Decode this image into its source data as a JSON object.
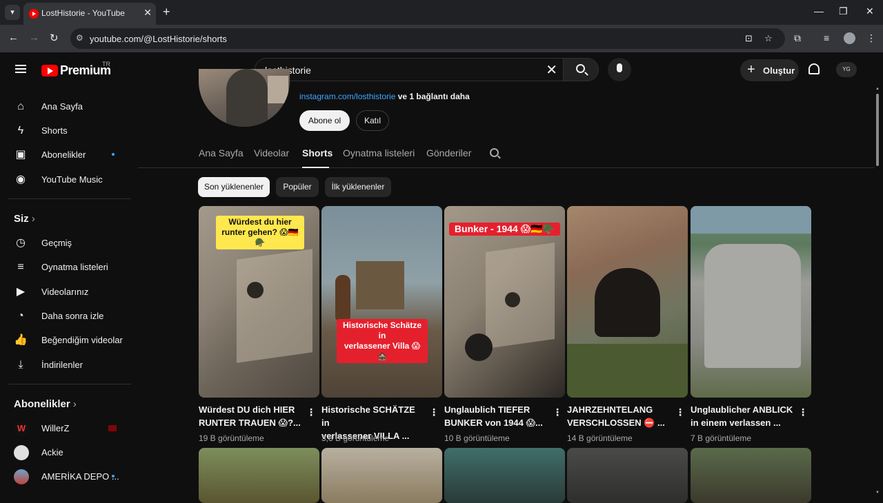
{
  "browser": {
    "tab_title": "LostHistorie - YouTube",
    "url": "youtube.com/@LostHistorie/shorts",
    "close_symbol": "✕",
    "newtab_symbol": "+"
  },
  "header": {
    "logo_text": "Premium",
    "country_code": "TR",
    "search_value": "losthistorie",
    "create_label": "Oluştur",
    "avatar_text": "YG"
  },
  "sidebar": {
    "main_items": [
      {
        "label": "Ana Sayfa",
        "icon": "home-icon"
      },
      {
        "label": "Shorts",
        "icon": "shorts-icon"
      },
      {
        "label": "Abonelikler",
        "icon": "subscriptions-icon",
        "dot": true
      },
      {
        "label": "YouTube Music",
        "icon": "music-icon"
      }
    ],
    "you_heading": "Siz",
    "you_items": [
      {
        "label": "Geçmiş",
        "icon": "history-icon"
      },
      {
        "label": "Oynatma listeleri",
        "icon": "playlists-icon"
      },
      {
        "label": "Videolarınız",
        "icon": "your-videos-icon"
      },
      {
        "label": "Daha sonra izle",
        "icon": "watch-later-icon"
      },
      {
        "label": "Beğendiğim videolar",
        "icon": "liked-icon"
      },
      {
        "label": "İndirilenler",
        "icon": "downloads-icon"
      }
    ],
    "subs_heading": "Abonelikler",
    "subs": [
      {
        "label": "WillerZ"
      },
      {
        "label": "Ackie"
      },
      {
        "label": "AMERİKA DEPO ..."
      }
    ]
  },
  "channel": {
    "link_text": "instagram.com/losthistorie",
    "link_more": "ve 1 bağlantı daha",
    "subscribe_label": "Abone ol",
    "join_label": "Katıl",
    "tabs": [
      "Ana Sayfa",
      "Videolar",
      "Shorts",
      "Oynatma listeleri",
      "Gönderiler"
    ],
    "active_tab": "Shorts"
  },
  "chips": [
    "Son yüklenenler",
    "Popüler",
    "İlk yüklenenler"
  ],
  "shorts": [
    {
      "title_line1": "Würdest DU dich HIER",
      "title_line2": "RUNTER TRAUEN 😱?...",
      "views": "19 B görüntüleme",
      "overlay_line1": "Würdest du hier",
      "overlay_line2": "runter gehen? 😱🇩🇪🪖"
    },
    {
      "title_line1": "Historische SCHÄTZE in",
      "title_line2": "verlassener VILLA ...",
      "views": "3,8 B görüntüleme",
      "overlay_line1": "Historische Schätze in",
      "overlay_line2": "verlassener Villa 😱🏚️"
    },
    {
      "title_line1": "Unglaublich TIEFER",
      "title_line2": "BUNKER von 1944 😱...",
      "views": "10 B görüntüleme",
      "overlay_line1": "Bunker - 1944 😱🇩🇪🪖",
      "overlay_line2": ""
    },
    {
      "title_line1": "JAHRZEHNTELANG",
      "title_line2": "VERSCHLOSSEN ⛔ ...",
      "views": "14 B görüntüleme"
    },
    {
      "title_line1": "Unglaublicher ANBLICK",
      "title_line2": "in einem verlassen ...",
      "views": "7 B görüntüleme"
    }
  ],
  "menu_symbol": "⋮"
}
